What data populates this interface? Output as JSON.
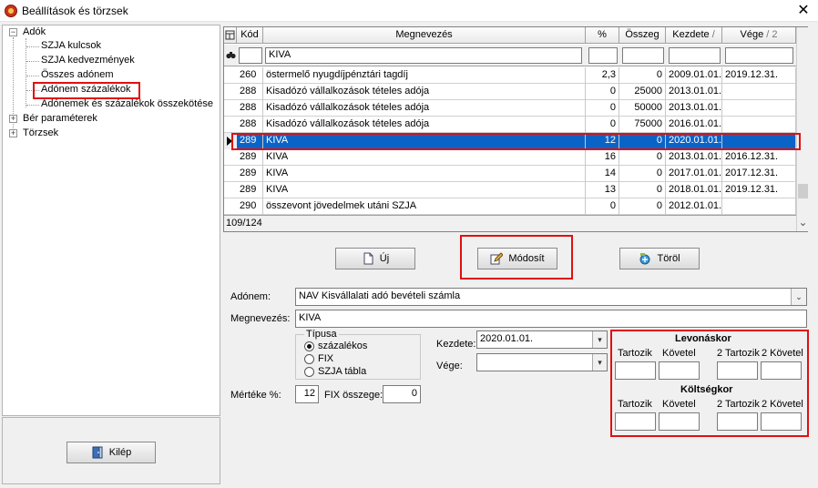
{
  "window": {
    "title": "Beállítások és törzsek",
    "close": "✕"
  },
  "tree": {
    "root": "Adók",
    "children": [
      "SZJA kulcsok",
      "SZJA kedvezmények",
      "Összes adónem",
      "Adónem százalékok",
      "Adónemek és százalékok összekötése"
    ],
    "others": [
      "Bér paraméterek",
      "Törzsek"
    ],
    "expander_open": "−",
    "expander_closed": "+"
  },
  "exit_button": "Kilép",
  "grid": {
    "headers": [
      "Kód",
      "Megnevezés",
      "%",
      "Összeg",
      "Kezdete",
      "Vége"
    ],
    "sort_marker": "/",
    "sort_number": "/ 2",
    "filter": {
      "kod": "",
      "megnevezes": "KIVA",
      "pct": "",
      "osszeg": "",
      "kezdete": "",
      "vege": ""
    },
    "rows": [
      [
        "260",
        "östermelő nyugdíjpénztári tagdíj",
        "2,3",
        "0",
        "2009.01.01.",
        "2019.12.31."
      ],
      [
        "288",
        "Kisadózó vállalkozások tételes adója",
        "0",
        "25000",
        "2013.01.01.",
        ""
      ],
      [
        "288",
        "Kisadózó vállalkozások tételes adója",
        "0",
        "50000",
        "2013.01.01.",
        ""
      ],
      [
        "288",
        "Kisadózó vállalkozások tételes adója",
        "0",
        "75000",
        "2016.01.01.",
        ""
      ],
      [
        "289",
        "KIVA",
        "12",
        "0",
        "2020.01.01.",
        ""
      ],
      [
        "289",
        "KIVA",
        "16",
        "0",
        "2013.01.01.",
        "2016.12.31."
      ],
      [
        "289",
        "KIVA",
        "14",
        "0",
        "2017.01.01.",
        "2017.12.31."
      ],
      [
        "289",
        "KIVA",
        "13",
        "0",
        "2018.01.01.",
        "2019.12.31."
      ],
      [
        "290",
        "összevont jövedelmek utáni SZJA",
        "0",
        "0",
        "2012.01.01.",
        ""
      ]
    ],
    "selected_index": 4,
    "count": "109/124",
    "scroll_down": "⌄"
  },
  "buttons": {
    "new": "Új",
    "modify": "Módosít",
    "delete": "Töröl"
  },
  "form": {
    "adonem_label": "Adónem:",
    "adonem_value": "NAV Kisvállalati adó bevételi számla",
    "megnevezes_label": "Megnevezés:",
    "megnevezes_value": "KIVA",
    "tipusa_label": "Típusa",
    "radio_options": [
      "százalékos",
      "FIX",
      "SZJA tábla"
    ],
    "radio_selected": 0,
    "kezdete_label": "Kezdete:",
    "kezdete_value": "2020.01.01.",
    "vege_label": "Vége:",
    "vege_value": "",
    "merteke_label": "Mértéke %:",
    "merteke_value": "12",
    "fix_label": "FIX összege:",
    "fix_value": "0"
  },
  "accounts": {
    "levonaskor": "Levonáskor",
    "koltsegkor": "Költségkor",
    "cols": [
      "Tartozik",
      "Követel",
      "2 Tartozik",
      "2 Követel"
    ]
  },
  "colors": {
    "highlight": "#e01010",
    "selection": "#0a64c8"
  }
}
